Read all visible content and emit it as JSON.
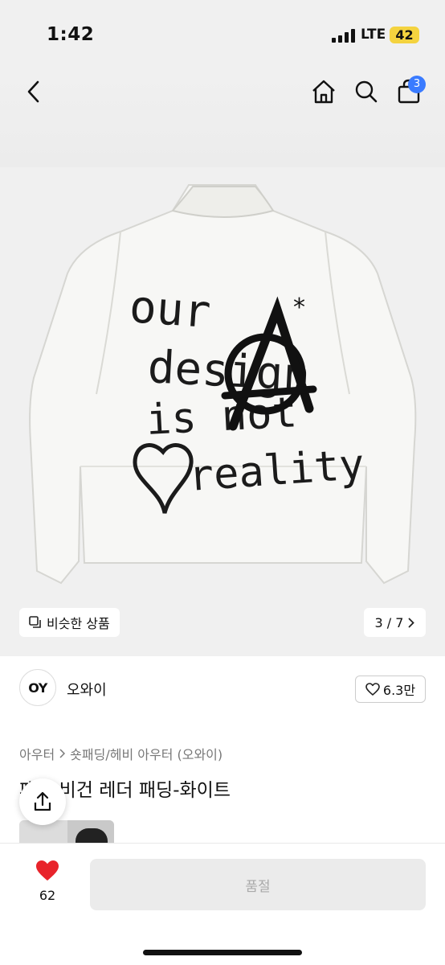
{
  "status_bar": {
    "time": "1:42",
    "network": "LTE",
    "battery": "42"
  },
  "nav": {
    "cart_count": "3"
  },
  "artwork_text": [
    "our",
    "design",
    "is not",
    "reality"
  ],
  "image": {
    "similar_label": "비슷한 상품",
    "page_counter": "3 / 7"
  },
  "seller": {
    "avatar_text": "OY",
    "name": "오와이",
    "like_count": "6.3만"
  },
  "breadcrumb": {
    "level1": "아우터",
    "level2": "숏패딩/헤비 아우터 (오와이)"
  },
  "product": {
    "title": "패딩 비건 레더 패딩-화이트"
  },
  "bottom": {
    "wish_count": "62",
    "action_label": "품절"
  },
  "colors": {
    "accent": "#3a7bff",
    "heart": "#e8242b",
    "battery": "#f4d33f"
  }
}
